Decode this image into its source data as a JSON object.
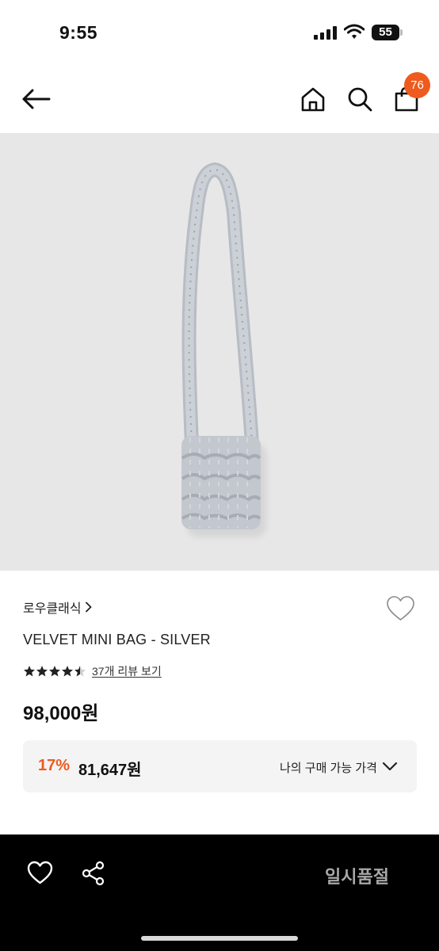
{
  "status_bar": {
    "time": "9:55",
    "battery": "55"
  },
  "nav": {
    "cart_count": "76"
  },
  "product": {
    "brand": "로우클래식",
    "name": "VELVET MINI BAG - SILVER",
    "rating": 4.5,
    "review_link": "37개 리뷰 보기",
    "price": "98,000원",
    "image_icon": "ruched-velvet-mini-bag"
  },
  "discount": {
    "rate": "17%",
    "price": "81,647원",
    "label": "나의 구매 가능 가격"
  },
  "bottom_bar": {
    "sold_out_label": "일시품절"
  },
  "colors": {
    "accent": "#ef5a1e",
    "image_bg": "#e7e7e7",
    "bottom_bar_bg": "#000000"
  }
}
